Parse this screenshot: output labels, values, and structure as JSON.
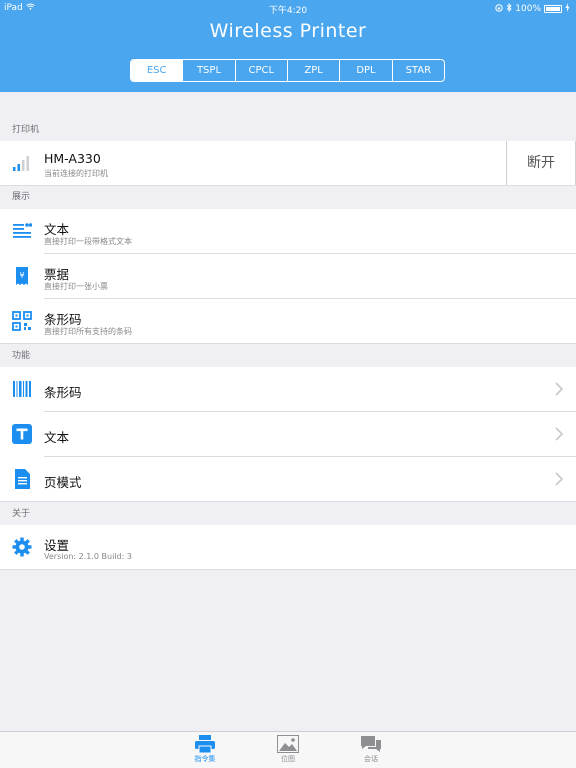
{
  "status_bar": {
    "device": "iPad",
    "time": "下午4:20",
    "battery": "100%"
  },
  "header": {
    "title": "Wireless Printer"
  },
  "tabs": [
    {
      "label": "ESC",
      "active": true
    },
    {
      "label": "TSPL",
      "active": false
    },
    {
      "label": "CPCL",
      "active": false
    },
    {
      "label": "ZPL",
      "active": false
    },
    {
      "label": "DPL",
      "active": false
    },
    {
      "label": "STAR",
      "active": false
    }
  ],
  "sections": {
    "printer": {
      "header": "打印机",
      "device_name": "HM-A330",
      "device_sub": "当前连接的打印机",
      "disconnect_label": "断开"
    },
    "demo": {
      "header": "展示",
      "items": [
        {
          "title": "文本",
          "subtitle": "直接打印一段带格式文本",
          "icon": "text-lines-icon"
        },
        {
          "title": "票据",
          "subtitle": "直接打印一张小票",
          "icon": "receipt-icon"
        },
        {
          "title": "条形码",
          "subtitle": "直接打印所有支持的条码",
          "icon": "qrcode-icon"
        }
      ]
    },
    "functions": {
      "header": "功能",
      "items": [
        {
          "title": "条形码",
          "icon": "barcode-icon"
        },
        {
          "title": "文本",
          "icon": "text-t-icon"
        },
        {
          "title": "页模式",
          "icon": "document-icon"
        }
      ]
    },
    "about": {
      "header": "关于",
      "settings_title": "设置",
      "version_text": "Version: 2.1.0  Build: 3"
    }
  },
  "tabbar": [
    {
      "label": "指令集",
      "icon": "printer-icon",
      "active": true
    },
    {
      "label": "位图",
      "icon": "image-icon",
      "active": false
    },
    {
      "label": "会话",
      "icon": "chat-icon",
      "active": false
    }
  ],
  "colors": {
    "accent": "#4aa6ee",
    "icon_blue": "#1b8ef0",
    "background": "#efeff4"
  }
}
